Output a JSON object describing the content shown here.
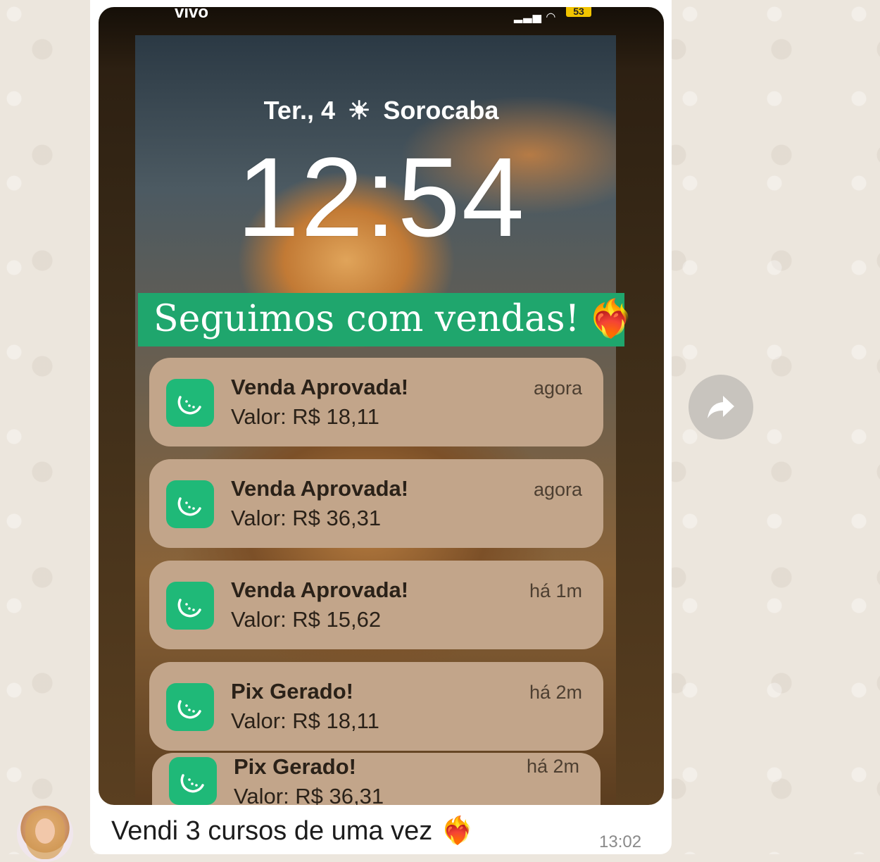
{
  "chat": {
    "message_text": "Vendi 3 cursos de uma vez",
    "message_emoji": "❤️‍🔥",
    "message_time": "13:02",
    "forward_icon": "forward-arrow-icon",
    "avatar_icon": "contact-avatar"
  },
  "phone": {
    "carrier": "vivo",
    "battery": "53",
    "date": "Ter., 4",
    "weather_icon": "sun-icon",
    "city": "Sorocaba",
    "clock": "12:54",
    "banner_text": "Seguimos com vendas!",
    "banner_emoji": "❤️‍🔥",
    "banner_color": "#1fa66d",
    "app_icon": "melon-slice-icon",
    "app_icon_color": "#1fb978",
    "notifications": [
      {
        "title": "Venda Aprovada!",
        "value": "Valor: R$ 18,11",
        "time": "agora"
      },
      {
        "title": "Venda Aprovada!",
        "value": "Valor: R$ 36,31",
        "time": "agora"
      },
      {
        "title": "Venda Aprovada!",
        "value": "Valor: R$ 15,62",
        "time": "há 1m"
      },
      {
        "title": "Pix Gerado!",
        "value": "Valor: R$ 18,11",
        "time": "há 2m"
      },
      {
        "title": "Pix Gerado!",
        "value": "Valor: R$ 36,31",
        "time": "há 2m"
      }
    ]
  }
}
